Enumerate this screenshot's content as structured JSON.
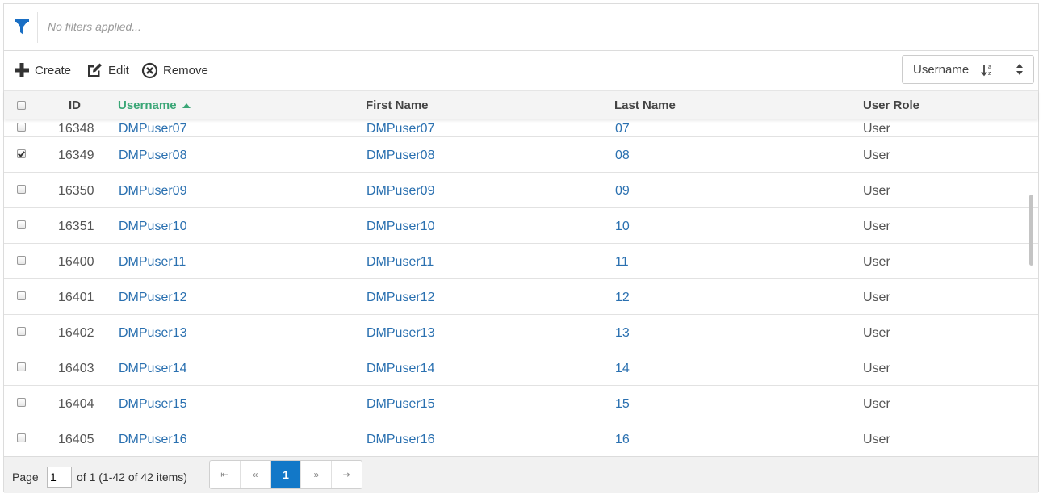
{
  "filter": {
    "text": "No filters applied..."
  },
  "toolbar": {
    "create_label": "Create",
    "edit_label": "Edit",
    "remove_label": "Remove",
    "sort_value": "Username"
  },
  "table": {
    "columns": {
      "id": "ID",
      "username": "Username",
      "first_name": "First Name",
      "last_name": "Last Name",
      "user_role": "User Role"
    },
    "sorted_column": "username",
    "sort_direction": "ascending",
    "rows": [
      {
        "checked": false,
        "id": "16348",
        "username": "DMPuser07",
        "first_name": "DMPuser07",
        "last_name": "07",
        "role": "User"
      },
      {
        "checked": true,
        "id": "16349",
        "username": "DMPuser08",
        "first_name": "DMPuser08",
        "last_name": "08",
        "role": "User"
      },
      {
        "checked": false,
        "id": "16350",
        "username": "DMPuser09",
        "first_name": "DMPuser09",
        "last_name": "09",
        "role": "User"
      },
      {
        "checked": false,
        "id": "16351",
        "username": "DMPuser10",
        "first_name": "DMPuser10",
        "last_name": "10",
        "role": "User"
      },
      {
        "checked": false,
        "id": "16400",
        "username": "DMPuser11",
        "first_name": "DMPuser11",
        "last_name": "11",
        "role": "User"
      },
      {
        "checked": false,
        "id": "16401",
        "username": "DMPuser12",
        "first_name": "DMPuser12",
        "last_name": "12",
        "role": "User"
      },
      {
        "checked": false,
        "id": "16402",
        "username": "DMPuser13",
        "first_name": "DMPuser13",
        "last_name": "13",
        "role": "User"
      },
      {
        "checked": false,
        "id": "16403",
        "username": "DMPuser14",
        "first_name": "DMPuser14",
        "last_name": "14",
        "role": "User"
      },
      {
        "checked": false,
        "id": "16404",
        "username": "DMPuser15",
        "first_name": "DMPuser15",
        "last_name": "15",
        "role": "User"
      },
      {
        "checked": false,
        "id": "16405",
        "username": "DMPuser16",
        "first_name": "DMPuser16",
        "last_name": "16",
        "role": "User"
      }
    ]
  },
  "pager": {
    "page_label": "Page",
    "page_value": "1",
    "summary": "of 1 (1-42 of 42 items)",
    "first_glyph": "⇤",
    "prev_glyph": "«",
    "current_page": "1",
    "next_glyph": "»",
    "last_glyph": "⇥"
  },
  "colors": {
    "accent": "#1278c8",
    "link": "#2a70b0",
    "sorted_header": "#3aa676"
  }
}
